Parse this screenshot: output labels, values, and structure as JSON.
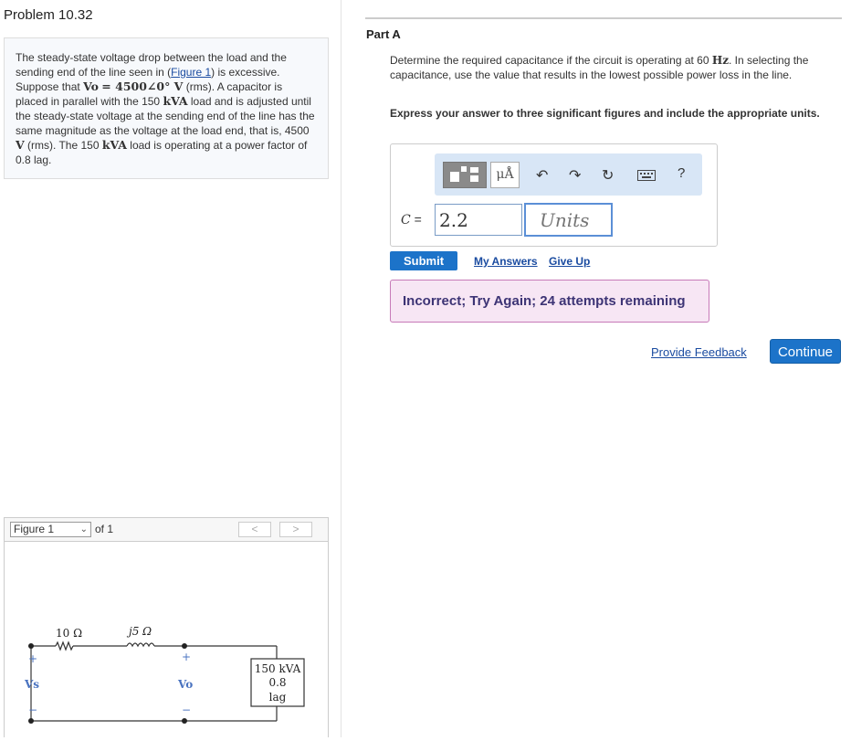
{
  "problem": {
    "title": "Problem 10.32",
    "text_1": "The steady-state voltage drop between the load and the sending end of the line seen in (",
    "figure_link": "Figure 1",
    "text_2": ") is excessive. Suppose that ",
    "vo_symbol": "Vo",
    "vo_value": "= 4500∠0° V",
    "text_3": " (rms). A capacitor is placed in parallel with the 150 ",
    "kva_unit": "kVA",
    "text_4": " load and is adjusted until the steady-state voltage at the sending end of the line has the same magnitude as the voltage at the load end, that is, 4500 ",
    "v_unit": "V",
    "text_5": " (rms). The 150 ",
    "text_6": " load is operating at a power factor of 0.8 lag."
  },
  "figure_panel": {
    "selected": "Figure 1",
    "of_text": "of 1",
    "prev": "<",
    "next": ">",
    "circuit": {
      "r_label": "10 Ω",
      "x_label": "j5 Ω",
      "vs_label": "Vs",
      "vo_label": "Vo",
      "plus": "+",
      "minus": "−",
      "load_line1": "150 kVA",
      "load_line2": "0.8",
      "load_line3": "lag"
    }
  },
  "part_a": {
    "title": "Part A",
    "question_1": "Determine the required capacitance if the circuit is operating at 60 ",
    "hz_unit": "Hz",
    "question_2": ". In selecting the capacitance, use the value that results in the lowest possible power loss in the line.",
    "instructions": "Express your answer to three significant figures and include the appropriate units.",
    "toolbar": {
      "units_label": "μÅ",
      "help": "?"
    },
    "variable": "C",
    "equals": "=",
    "value": "2.2",
    "units_placeholder": "Units",
    "submit": "Submit",
    "my_answers": "My Answers",
    "give_up": "Give Up",
    "feedback": "Incorrect; Try Again; 24 attempts remaining"
  },
  "footer": {
    "provide_feedback": "Provide Feedback",
    "continue": "Continue"
  }
}
